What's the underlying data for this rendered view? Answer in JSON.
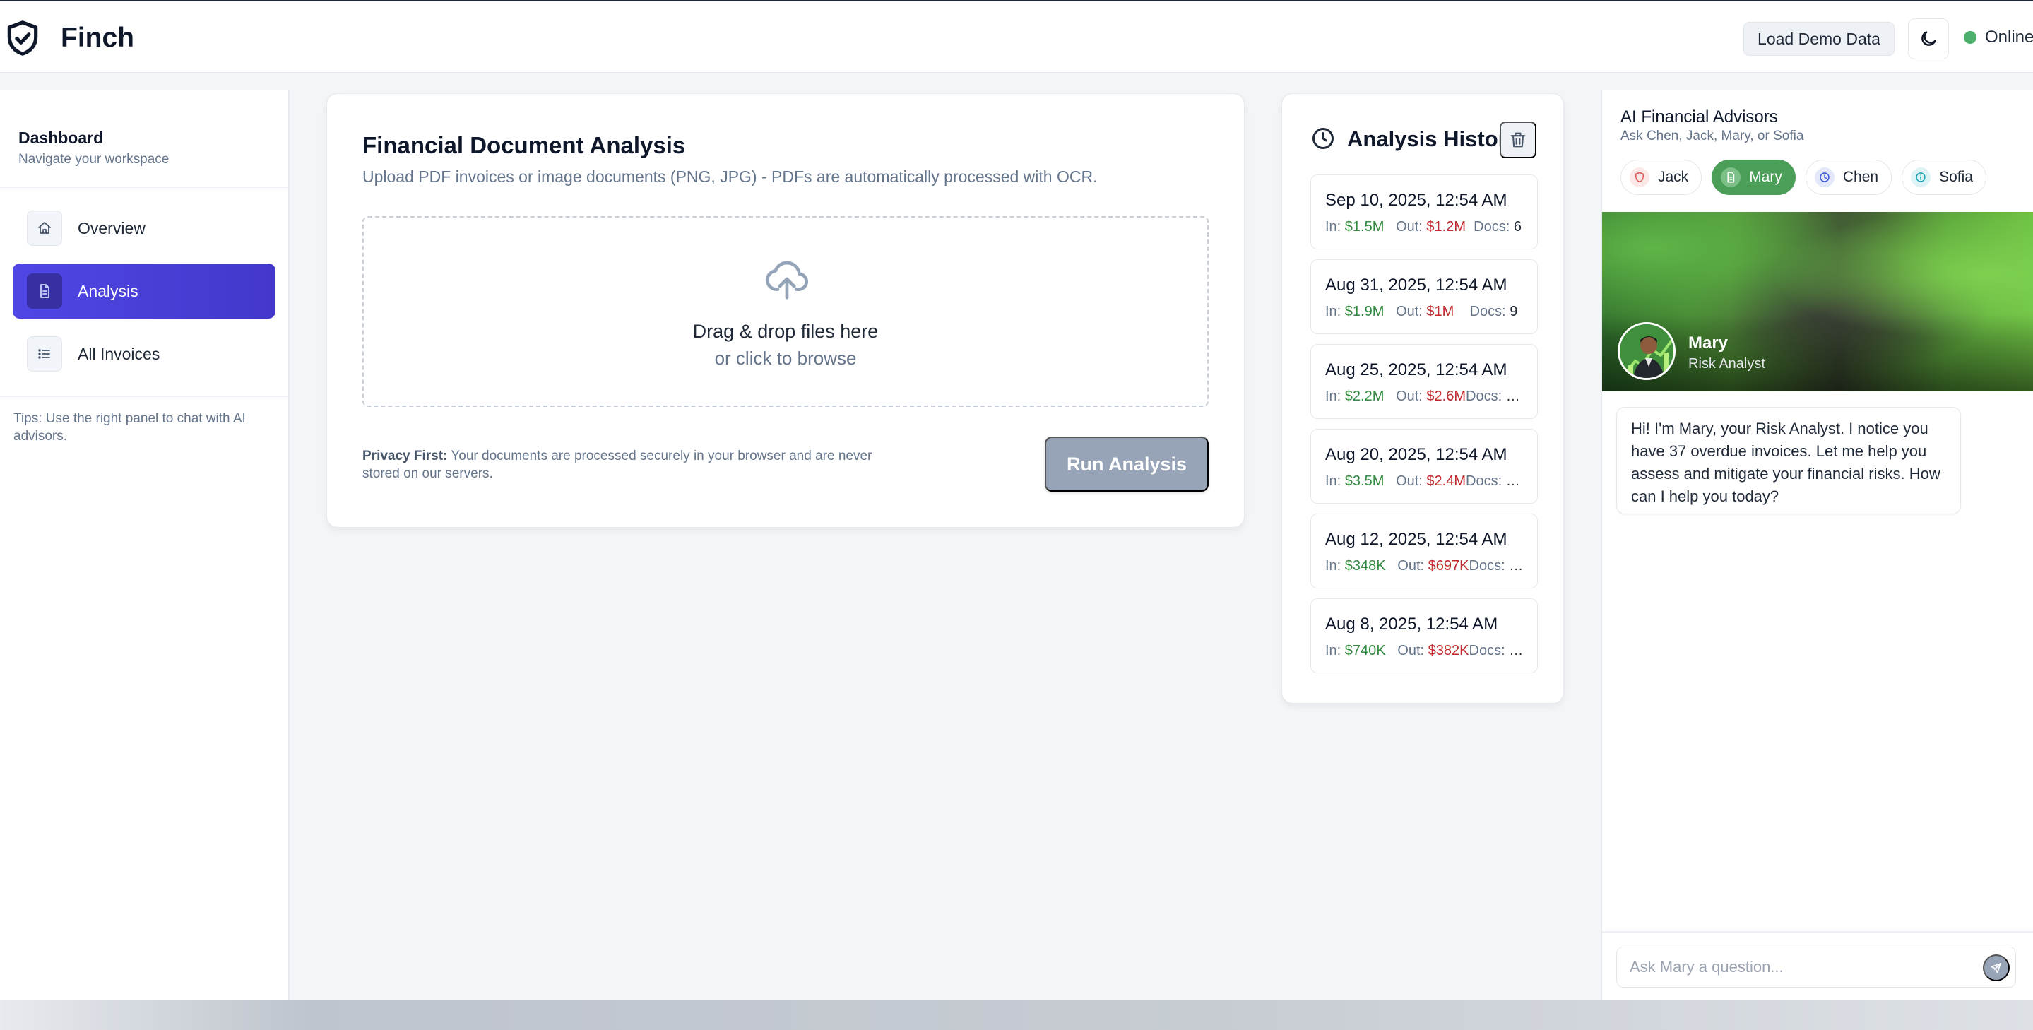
{
  "header": {
    "brand": "Finch",
    "load_demo": "Load Demo Data",
    "status": "Online",
    "colors": {
      "status": "#4caf6b"
    }
  },
  "sidebar": {
    "title": "Dashboard",
    "subtitle": "Navigate your workspace",
    "items": [
      {
        "label": "Overview",
        "icon": "home-icon"
      },
      {
        "label": "Analysis",
        "icon": "document-icon",
        "active": true
      },
      {
        "label": "All Invoices",
        "icon": "list-icon"
      }
    ],
    "tips": "Tips: Use the right panel to chat with AI advisors.",
    "colors": {
      "active": "#4338ca"
    }
  },
  "analysis": {
    "title": "Financial Document Analysis",
    "subtitle": "Upload PDF invoices or image documents (PNG, JPG) - PDFs are automatically processed with OCR.",
    "drop_main": "Drag & drop files here",
    "drop_sub": "or click to browse",
    "privacy_label": "Privacy First:",
    "privacy_text": " Your documents are processed securely in your browser and are never stored on our servers.",
    "run_button": "Run Analysis"
  },
  "history": {
    "title": "Analysis History",
    "in_label": "In: ",
    "out_label": "Out: ",
    "docs_label": "Docs: ",
    "items": [
      {
        "date": "Sep 10, 2025, 12:54 AM",
        "in": "$1.5M",
        "out": "$1.2M",
        "docs": "6"
      },
      {
        "date": "Aug 31, 2025, 12:54 AM",
        "in": "$1.9M",
        "out": "$1M",
        "docs": "9"
      },
      {
        "date": "Aug 25, 2025, 12:54 AM",
        "in": "$2.2M",
        "out": "$2.6M",
        "docs": "…"
      },
      {
        "date": "Aug 20, 2025, 12:54 AM",
        "in": "$3.5M",
        "out": "$2.4M",
        "docs": "…"
      },
      {
        "date": "Aug 12, 2025, 12:54 AM",
        "in": "$348K",
        "out": "$697K",
        "docs": "…"
      },
      {
        "date": "Aug 8, 2025, 12:54 AM",
        "in": "$740K",
        "out": "$382K",
        "docs": "…"
      }
    ],
    "colors": {
      "in": "#2f8a3e",
      "out": "#c0292b"
    }
  },
  "chat": {
    "title": "AI Financial Advisors",
    "subtitle": "Ask Chen, Jack, Mary, or Sofia",
    "advisors": [
      {
        "name": "Jack",
        "icon": "shield-icon",
        "color": "#e05252"
      },
      {
        "name": "Mary",
        "icon": "document-icon",
        "color": "#4a9e57",
        "active": true
      },
      {
        "name": "Chen",
        "icon": "clock-icon",
        "color": "#3b5bdb"
      },
      {
        "name": "Sofia",
        "icon": "info-icon",
        "color": "#1aa3b8"
      }
    ],
    "active": {
      "name": "Mary",
      "role": "Risk Analyst"
    },
    "message": "Hi! I'm Mary, your Risk Analyst. I notice you have 37 overdue invoices. Let me help you assess and mitigate your financial risks. How can I help you today?",
    "input_placeholder": "Ask Mary a question..."
  }
}
